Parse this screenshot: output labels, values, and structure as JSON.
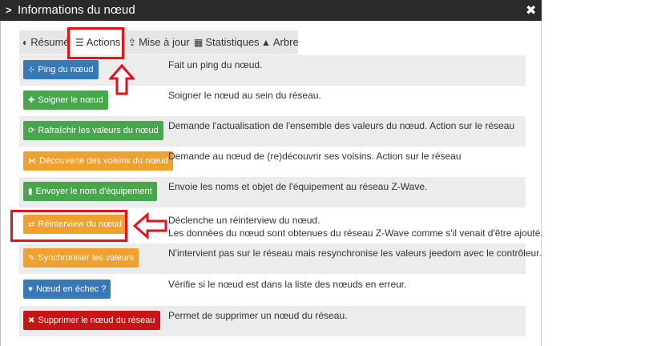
{
  "dialog": {
    "title": "Informations du nœud",
    "chevron_glyph": ">",
    "close_glyph": "✖"
  },
  "tabs": [
    {
      "label": "Résumé",
      "icon": "dashboard-icon",
      "glyph": "◐",
      "active": false
    },
    {
      "label": "Actions",
      "icon": "sliders-icon",
      "glyph": "☰",
      "active": true
    },
    {
      "label": "Mise à jour",
      "icon": "update-icon",
      "glyph": "⇪",
      "active": false
    },
    {
      "label": "Statistiques",
      "icon": "chart-icon",
      "glyph": "▦",
      "active": false
    },
    {
      "label": "Arbre",
      "icon": "tree-icon",
      "glyph": "▲",
      "active": false
    }
  ],
  "actions": [
    {
      "button": "Ping du nœud",
      "icon": "network-icon",
      "glyph": "⊹",
      "color": "#3778b7",
      "description": "Fait un ping du nœud."
    },
    {
      "button": "Soigner le nœud",
      "icon": "medkit-icon",
      "glyph": "✚",
      "color": "#48a64c",
      "description": "Soigner le nœud au sein du réseau."
    },
    {
      "button": "Rafraîchir les valeurs du nœud",
      "icon": "refresh-icon",
      "glyph": "⟳",
      "color": "#48a64c",
      "description": "Demande l'actualisation de l'ensemble des valeurs du nœud. Action sur le réseau"
    },
    {
      "button": "Découverte des voisins du nœud",
      "icon": "share-icon",
      "glyph": "⋈",
      "color": "#f0a12d",
      "description": "Demande au nœud de (re)découvrir ses voisins. Action sur le réseau"
    },
    {
      "button": "Envoyer le nom d'équipement",
      "icon": "bookmark-icon",
      "glyph": "▮",
      "color": "#48a64c",
      "description": "Envoie les noms et objet de l'équipement au réseau Z-Wave."
    },
    {
      "button": "Réinterview du nœud",
      "icon": "retweet-icon",
      "glyph": "⇄",
      "color": "#f0a12d",
      "description": "Déclenche un réinterview du nœud.",
      "description_line2": "Les données du nœud sont obtenues du réseau Z-Wave comme s'il venait d'être ajouté."
    },
    {
      "button": "Synchroniser les valeurs",
      "icon": "wrench-icon",
      "glyph": "✎",
      "color": "#f0a12d",
      "description": "N'intervient pas sur le réseau mais resynchronise les valeurs jeedom avec le contrôleur."
    },
    {
      "button": "Nœud en échec ?",
      "icon": "heartbeat-icon",
      "glyph": "♥",
      "color": "#3778b7",
      "description": "Vérifie si le nœud est dans la liste des nœuds en erreur."
    },
    {
      "button": "Supprimer le nœud du réseau",
      "icon": "times-icon",
      "glyph": "✖",
      "color": "#c81414",
      "description": "Permet de supprimer un nœud du réseau."
    }
  ],
  "annotations": {
    "highlight_color": "#e8111b"
  }
}
